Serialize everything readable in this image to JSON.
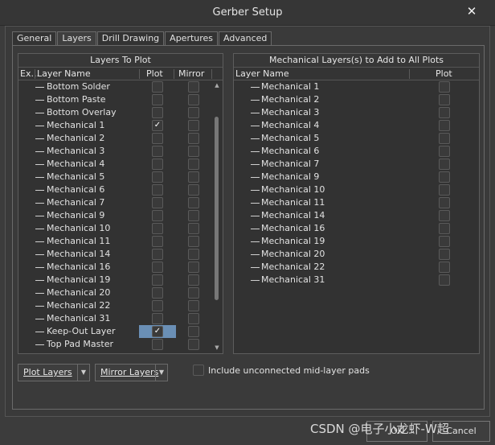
{
  "window": {
    "title": "Gerber Setup",
    "close_glyph": "✕"
  },
  "tabs": [
    "General",
    "Layers",
    "Drill Drawing",
    "Apertures",
    "Advanced"
  ],
  "active_tab": "Layers",
  "left_panel": {
    "header": "Layers To Plot",
    "columns": {
      "ex": "Ex...",
      "name": "Layer Name",
      "plot": "Plot",
      "mirror": "Mirror"
    },
    "rows": [
      {
        "name": "Bottom Solder",
        "plot": false,
        "mirror": false
      },
      {
        "name": "Bottom Paste",
        "plot": false,
        "mirror": false
      },
      {
        "name": "Bottom Overlay",
        "plot": false,
        "mirror": false
      },
      {
        "name": "Mechanical 1",
        "plot": true,
        "mirror": false
      },
      {
        "name": "Mechanical 2",
        "plot": false,
        "mirror": false
      },
      {
        "name": "Mechanical 3",
        "plot": false,
        "mirror": false
      },
      {
        "name": "Mechanical 4",
        "plot": false,
        "mirror": false
      },
      {
        "name": "Mechanical 5",
        "plot": false,
        "mirror": false
      },
      {
        "name": "Mechanical 6",
        "plot": false,
        "mirror": false
      },
      {
        "name": "Mechanical 7",
        "plot": false,
        "mirror": false
      },
      {
        "name": "Mechanical 9",
        "plot": false,
        "mirror": false
      },
      {
        "name": "Mechanical 10",
        "plot": false,
        "mirror": false
      },
      {
        "name": "Mechanical 11",
        "plot": false,
        "mirror": false
      },
      {
        "name": "Mechanical 14",
        "plot": false,
        "mirror": false
      },
      {
        "name": "Mechanical 16",
        "plot": false,
        "mirror": false
      },
      {
        "name": "Mechanical 19",
        "plot": false,
        "mirror": false
      },
      {
        "name": "Mechanical 20",
        "plot": false,
        "mirror": false
      },
      {
        "name": "Mechanical 22",
        "plot": false,
        "mirror": false
      },
      {
        "name": "Mechanical 31",
        "plot": false,
        "mirror": false
      },
      {
        "name": "Keep-Out Layer",
        "plot": true,
        "mirror": false,
        "selected": true
      },
      {
        "name": "Top Pad Master",
        "plot": false,
        "mirror": false
      }
    ]
  },
  "right_panel": {
    "header": "Mechanical Layers(s) to Add to All Plots",
    "columns": {
      "name": "Layer Name",
      "plot": "Plot"
    },
    "rows": [
      {
        "name": "Mechanical 1",
        "plot": false
      },
      {
        "name": "Mechanical 2",
        "plot": false
      },
      {
        "name": "Mechanical 3",
        "plot": false
      },
      {
        "name": "Mechanical 4",
        "plot": false
      },
      {
        "name": "Mechanical 5",
        "plot": false
      },
      {
        "name": "Mechanical 6",
        "plot": false
      },
      {
        "name": "Mechanical 7",
        "plot": false
      },
      {
        "name": "Mechanical 9",
        "plot": false
      },
      {
        "name": "Mechanical 10",
        "plot": false
      },
      {
        "name": "Mechanical 11",
        "plot": false
      },
      {
        "name": "Mechanical 14",
        "plot": false
      },
      {
        "name": "Mechanical 16",
        "plot": false
      },
      {
        "name": "Mechanical 19",
        "plot": false
      },
      {
        "name": "Mechanical 20",
        "plot": false
      },
      {
        "name": "Mechanical 22",
        "plot": false
      },
      {
        "name": "Mechanical 31",
        "plot": false
      }
    ]
  },
  "buttons": {
    "plot_layers": "Plot Layers",
    "mirror_layers": "Mirror Layers",
    "ok": "OK",
    "cancel": "Cancel"
  },
  "include_unconnected": {
    "label": "Include unconnected mid-layer pads",
    "checked": false
  },
  "watermark": "CSDN @电子小龙虾-W超",
  "colors": {
    "selection": "#6a8fb5",
    "background": "#3a3a3a"
  }
}
